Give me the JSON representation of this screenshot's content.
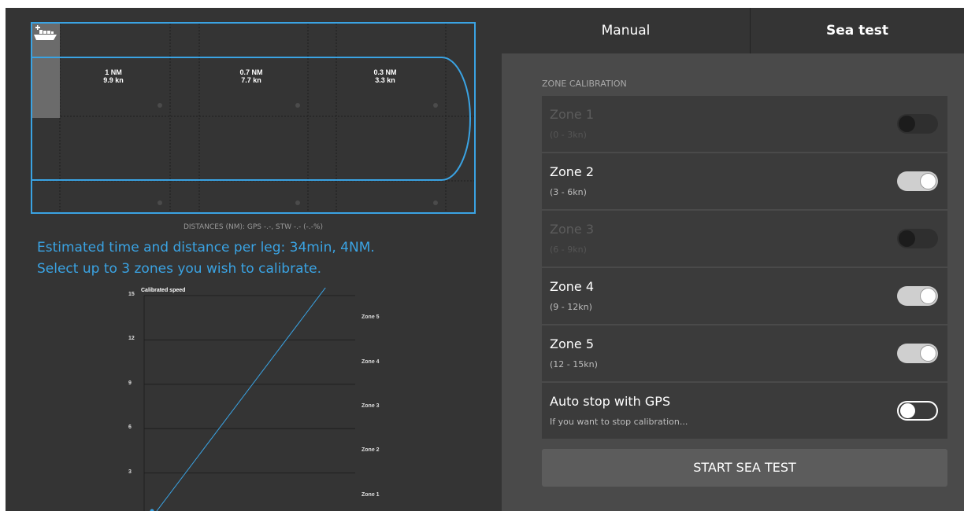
{
  "map": {
    "legs": [
      {
        "distance": "1 NM",
        "speed": "9.9 kn"
      },
      {
        "distance": "0.7 NM",
        "speed": "7.7 kn"
      },
      {
        "distance": "0.3 NM",
        "speed": "3.3 kn"
      }
    ],
    "distances_line": "DISTANCES (NM): GPS -.-, STW -.- (-.-%)",
    "estimate_line": "Estimated time and distance per leg: 34min, 4NM.",
    "select_line": "Select up to 3 zones you wish to calibrate."
  },
  "chart_data": {
    "type": "line",
    "title": "Calibrated speed",
    "y_ticks": [
      "15",
      "12",
      "9",
      "6",
      "3"
    ],
    "ylim": [
      0,
      15
    ],
    "zone_labels": [
      "Zone 5",
      "Zone 4",
      "Zone 3",
      "Zone 2",
      "Zone 1"
    ],
    "series": [
      {
        "x": [
          0,
          1
        ],
        "y": [
          0,
          15.8
        ]
      }
    ],
    "line_color": "#3aa3e3"
  },
  "tabs": {
    "manual": "Manual",
    "sea_test": "Sea test",
    "active": "sea_test"
  },
  "zone_calibration": {
    "label": "ZONE CALIBRATION",
    "zones": [
      {
        "name": "Zone 1",
        "range": "(0 - 3kn)",
        "state": "disabled"
      },
      {
        "name": "Zone 2",
        "range": "(3 - 6kn)",
        "state": "on"
      },
      {
        "name": "Zone 3",
        "range": "(6 - 9kn)",
        "state": "disabled"
      },
      {
        "name": "Zone 4",
        "range": "(9 - 12kn)",
        "state": "on"
      },
      {
        "name": "Zone 5",
        "range": "(12 - 15kn)",
        "state": "on"
      }
    ],
    "auto_stop": {
      "name": "Auto stop with GPS",
      "description": "If you want to stop calibration...",
      "state": "off"
    },
    "start_button": "START SEA TEST"
  },
  "colors": {
    "accent": "#3aa3e3",
    "background": "#343434",
    "panel": "#4a4a4a"
  }
}
